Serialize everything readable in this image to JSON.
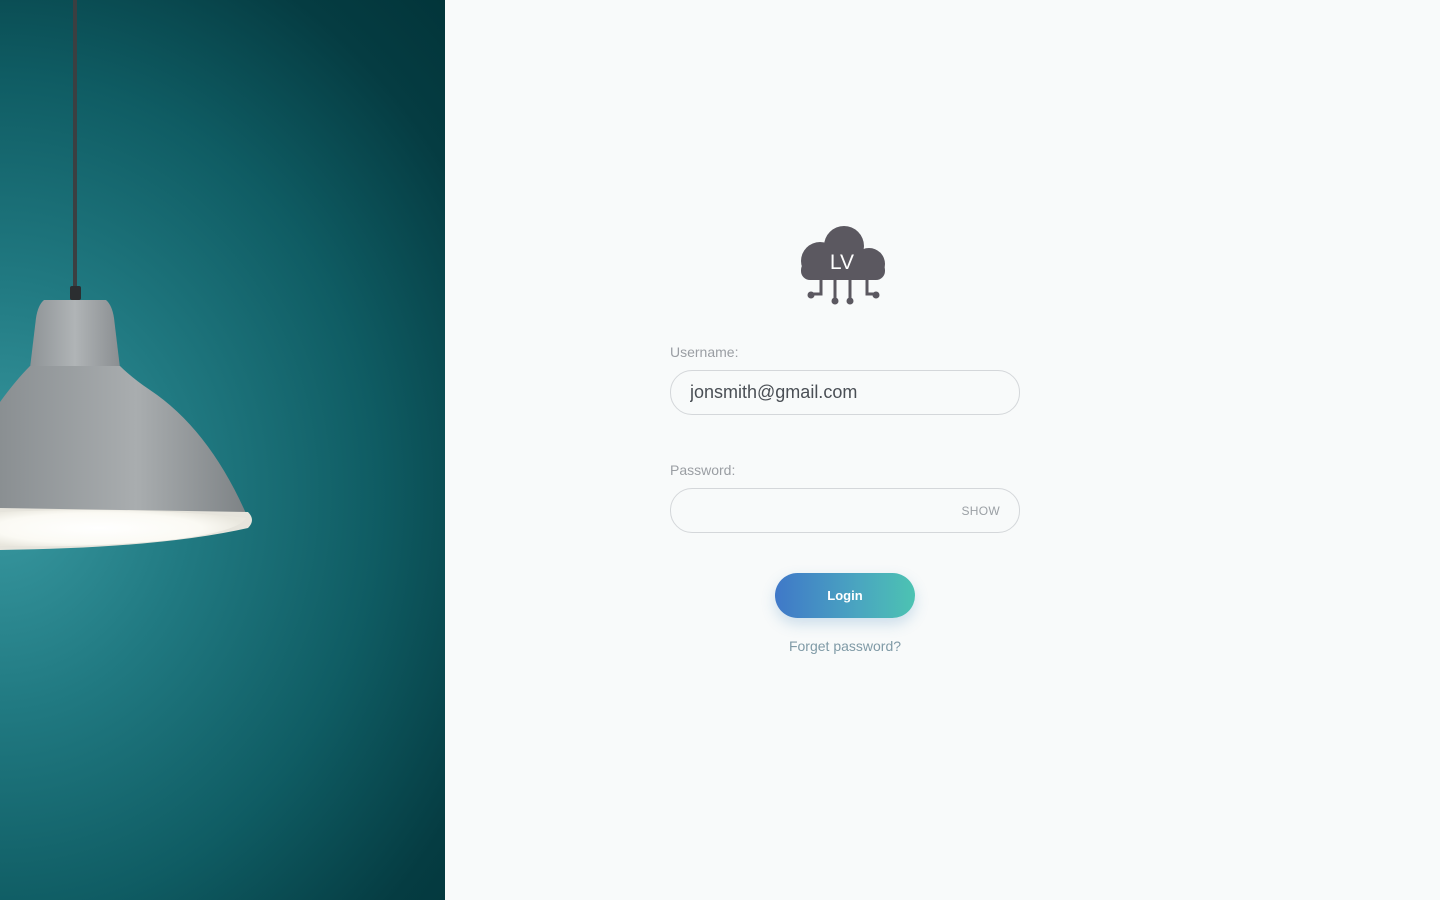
{
  "brand": {
    "logo_text": "LV",
    "logo_icon": "cloud-circuit-icon",
    "logo_color": "#5b5860"
  },
  "hero": {
    "image": "pendant-lamp-photo",
    "background_color": "#1a6e76"
  },
  "form": {
    "username_label": "Username:",
    "username_value": "jonsmith@gmail.com",
    "password_label": "Password:",
    "password_value": "",
    "show_label": "SHOW",
    "login_label": "Login",
    "forgot_label": "Forget password?"
  },
  "colors": {
    "login_gradient_start": "#3f78c8",
    "login_gradient_end": "#4cc3b2",
    "forgot_link": "#7f9aa6"
  }
}
